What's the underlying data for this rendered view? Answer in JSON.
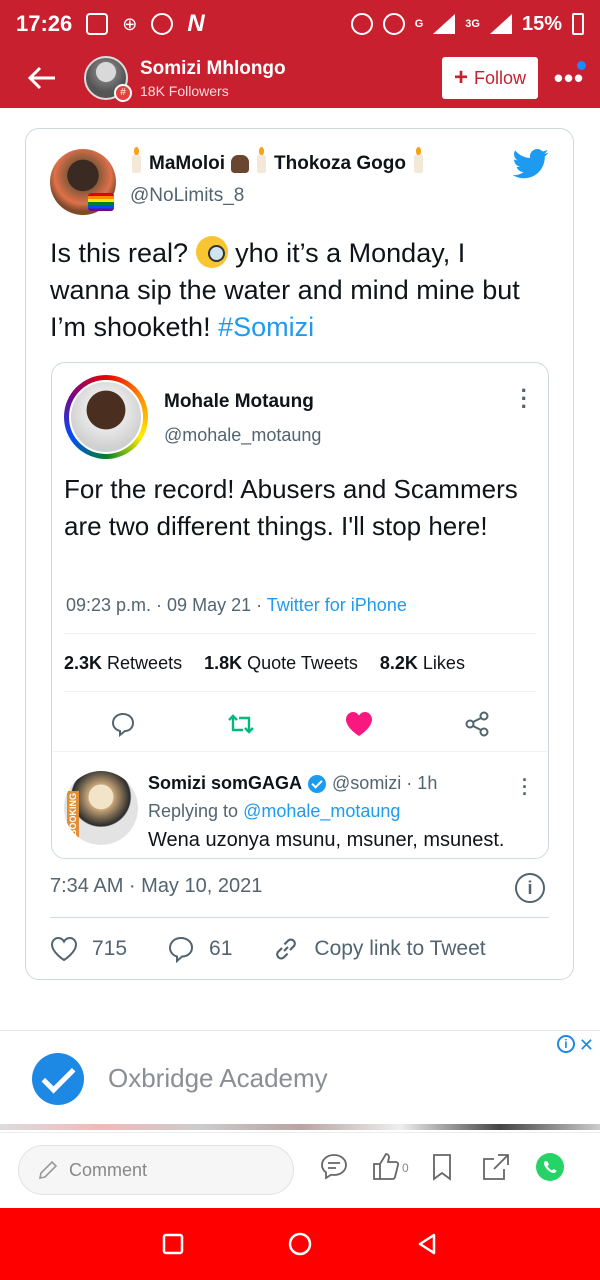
{
  "status_bar": {
    "time": "17:26",
    "network_label": "G",
    "network_label_2": "3G",
    "battery": "15%"
  },
  "app_bar": {
    "author_name": "Somizi Mhlongo",
    "followers": "18K Followers",
    "follow_label": "Follow",
    "more_label": "•••",
    "colors": {
      "bar": "#c8202e",
      "notification_dot": "#1e88ff"
    }
  },
  "tweet": {
    "name_part1": "MaMoloi",
    "name_part2": "Thokoza Gogo",
    "handle": "@NoLimits_8",
    "text_before_emoji": "Is this real?",
    "text_after_emoji": "yho it’s a Monday, I wanna sip the water and mind mine but I’m shooketh!",
    "hashtag": "#Somizi",
    "time": "7:34 AM · May 10, 2021",
    "likes": "715",
    "replies": "61",
    "copy_link": "Copy link to Tweet",
    "info_label": "i"
  },
  "quoted": {
    "name": "Mohale Motaung",
    "handle": "@mohale_motaung",
    "text": "For the record! Abusers and Scammers are two different things. I'll stop here!",
    "time": "09:23 p.m. · 09 May 21 ·",
    "source": "Twitter for iPhone",
    "stats": [
      {
        "count": "2.3K",
        "label": "Retweets"
      },
      {
        "count": "1.8K",
        "label": "Quote Tweets"
      },
      {
        "count": "8.2K",
        "label": "Likes"
      }
    ],
    "reply": {
      "name": "Somizi somGAGA",
      "handle": "@somizi · 1h",
      "replying_prefix": "Replying to",
      "replying_to": "@mohale_motaung",
      "text": "Wena uzonya msunu, msuner, msunest.",
      "avatar_tag": "BOOKING"
    }
  },
  "ad": {
    "name": "Oxbridge Academy",
    "close_label": "✕",
    "info_label": "i"
  },
  "bottom_bar": {
    "comment_placeholder": "Comment",
    "like_count": "0"
  }
}
